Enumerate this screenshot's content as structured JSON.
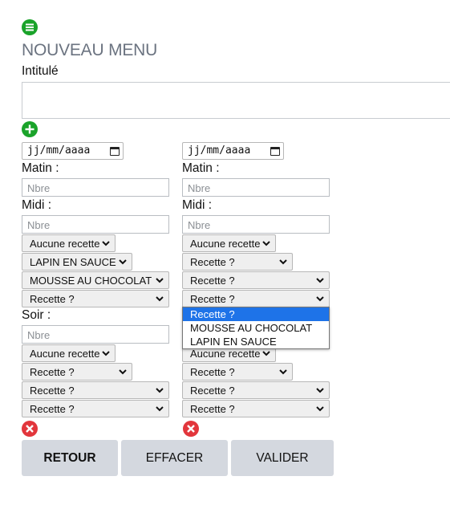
{
  "header": {
    "menu_icon": "hamburger-circle-icon",
    "title": "NOUVEAU MENU",
    "accent_green": "#1aa32a",
    "danger_red": "#e2363c"
  },
  "form": {
    "intitule_label": "Intitulé",
    "intitule_value": "",
    "add_icon": "plus-circle-icon"
  },
  "days": [
    {
      "date_placeholder": "jj/mm/aaaa",
      "matin_label": "Matin :",
      "matin_placeholder": "Nbre",
      "midi_label": "Midi :",
      "midi_placeholder": "Nbre",
      "midi_selects": [
        "Aucune recette",
        "LAPIN EN SAUCE",
        "MOUSSE AU CHOCOLAT",
        "Recette ?"
      ],
      "soir_label": "Soir :",
      "soir_placeholder": "Nbre",
      "soir_selects": [
        "Aucune recette",
        "Recette ?",
        "Recette ?",
        "Recette ?"
      ],
      "remove_icon": "close-circle-icon"
    },
    {
      "date_placeholder": "jj/mm/aaaa",
      "matin_label": "Matin :",
      "matin_placeholder": "Nbre",
      "midi_label": "Midi :",
      "midi_placeholder": "Nbre",
      "midi_selects": [
        "Aucune recette",
        "Recette ?",
        "Recette ?",
        "Recette ?"
      ],
      "soir_selects": [
        "Aucune recette",
        "Recette ?",
        "Recette ?",
        "Recette ?"
      ],
      "remove_icon": "close-circle-icon"
    }
  ],
  "dropdown": {
    "options": [
      "Recette ?",
      "MOUSSE AU CHOCOLAT",
      "LAPIN EN SAUCE"
    ],
    "selected": "Recette ?",
    "highlight_color": "#1e73e8"
  },
  "buttons": {
    "retour": "RETOUR",
    "effacer": "EFFACER",
    "valider": "VALIDER",
    "button_bg": "#d4d8df"
  }
}
